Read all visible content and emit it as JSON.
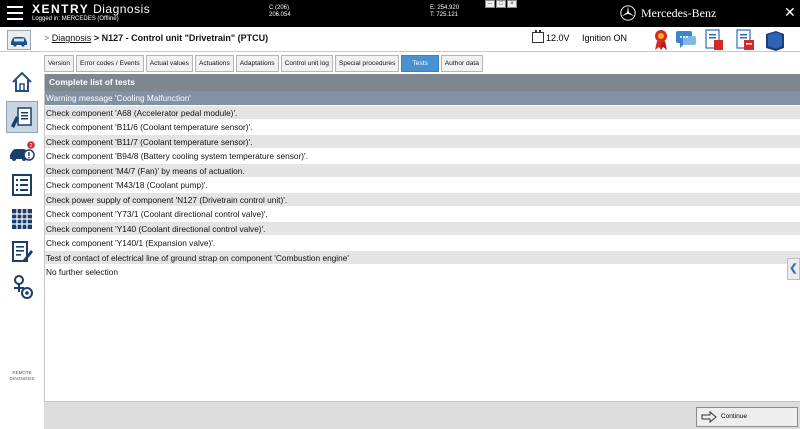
{
  "titlebar": {
    "brand_prefix": "XENTRY",
    "brand_suffix": "Diagnosis",
    "logged_in": "Logged in: MERCEDES (Offline)",
    "c_value": "C (206)",
    "c_sub": "206.054",
    "e_value": "E: 254.920",
    "t_value": "T: 725.121",
    "mercedes_brand": "Mercedes-Benz",
    "close_glyph": "✕"
  },
  "header": {
    "breadcrumb_sep": ">",
    "breadcrumb_link": "Diagnosis",
    "breadcrumb_current": "> N127 - Control unit \"Drivetrain\" (PTCU)",
    "voltage": "12.0V",
    "ignition": "Ignition ON"
  },
  "sidebar": {
    "items": [
      {
        "name": "home-icon"
      },
      {
        "name": "diagnosis-icon",
        "active": true
      },
      {
        "name": "vehicle-faults-icon",
        "badge": "2"
      },
      {
        "name": "list-icon"
      },
      {
        "name": "grid-icon"
      },
      {
        "name": "document-edit-icon"
      },
      {
        "name": "remote-settings-icon"
      }
    ],
    "remote_label_1": "REMOTE",
    "remote_label_2": "DIAGNOSIS"
  },
  "tabs": [
    {
      "label": "Version"
    },
    {
      "label": "Error codes / Events"
    },
    {
      "label": "Actual values"
    },
    {
      "label": "Actuations"
    },
    {
      "label": "Adaptations"
    },
    {
      "label": "Control unit log"
    },
    {
      "label": "Special procedures"
    },
    {
      "label": "Tests",
      "active": true
    },
    {
      "label": "Author data"
    }
  ],
  "panel": {
    "title": "Complete list of tests",
    "rows": [
      "Warning message 'Cooling Malfunction'",
      "Check component 'A68 (Accelerator pedal module)'.",
      "Check component 'B11/6 (Coolant temperature sensor)'.",
      "Check component 'B11/7 (Coolant temperature sensor)'.",
      "Check component 'B94/8 (Battery cooling system temperature sensor)'.",
      "Check component 'M4/7 (Fan)' by means of actuation.",
      "Check component 'M43/18 (Coolant pump)'.",
      "Check power supply of component 'N127 (Drivetrain control unit)'.",
      "Check component 'Y73/1 (Coolant directional control valve)'.",
      "Check component 'Y140 (Coolant directional control valve)'.",
      "Check component 'Y140/1 (Expansion valve)'.",
      "Test of contact of electrical line of ground strap on component 'Combustion engine'",
      "No further selection"
    ]
  },
  "side_tab_glyph": "❮",
  "footer": {
    "continue_label": "Continue"
  },
  "colors": {
    "accent_tab": "#4a92cf",
    "panel_header": "#7e8690",
    "selected_row": "#8292a4",
    "alt_row": "#e4e4e4"
  }
}
